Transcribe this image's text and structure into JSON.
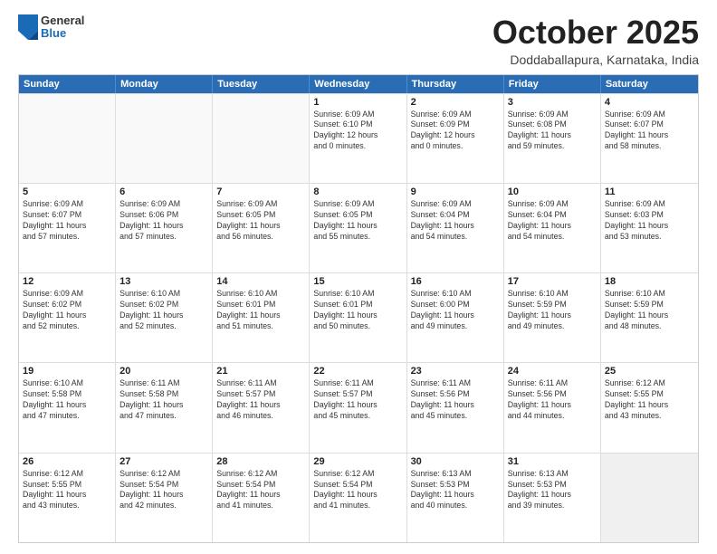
{
  "header": {
    "logo": {
      "general": "General",
      "blue": "Blue"
    },
    "title": "October 2025",
    "location": "Doddaballapura, Karnataka, India"
  },
  "calendar": {
    "weekdays": [
      "Sunday",
      "Monday",
      "Tuesday",
      "Wednesday",
      "Thursday",
      "Friday",
      "Saturday"
    ],
    "weeks": [
      [
        {
          "day": "",
          "lines": [],
          "empty": true
        },
        {
          "day": "",
          "lines": [],
          "empty": true
        },
        {
          "day": "",
          "lines": [],
          "empty": true
        },
        {
          "day": "1",
          "lines": [
            "Sunrise: 6:09 AM",
            "Sunset: 6:10 PM",
            "Daylight: 12 hours",
            "and 0 minutes."
          ]
        },
        {
          "day": "2",
          "lines": [
            "Sunrise: 6:09 AM",
            "Sunset: 6:09 PM",
            "Daylight: 12 hours",
            "and 0 minutes."
          ]
        },
        {
          "day": "3",
          "lines": [
            "Sunrise: 6:09 AM",
            "Sunset: 6:08 PM",
            "Daylight: 11 hours",
            "and 59 minutes."
          ]
        },
        {
          "day": "4",
          "lines": [
            "Sunrise: 6:09 AM",
            "Sunset: 6:07 PM",
            "Daylight: 11 hours",
            "and 58 minutes."
          ]
        }
      ],
      [
        {
          "day": "5",
          "lines": [
            "Sunrise: 6:09 AM",
            "Sunset: 6:07 PM",
            "Daylight: 11 hours",
            "and 57 minutes."
          ]
        },
        {
          "day": "6",
          "lines": [
            "Sunrise: 6:09 AM",
            "Sunset: 6:06 PM",
            "Daylight: 11 hours",
            "and 57 minutes."
          ]
        },
        {
          "day": "7",
          "lines": [
            "Sunrise: 6:09 AM",
            "Sunset: 6:05 PM",
            "Daylight: 11 hours",
            "and 56 minutes."
          ]
        },
        {
          "day": "8",
          "lines": [
            "Sunrise: 6:09 AM",
            "Sunset: 6:05 PM",
            "Daylight: 11 hours",
            "and 55 minutes."
          ]
        },
        {
          "day": "9",
          "lines": [
            "Sunrise: 6:09 AM",
            "Sunset: 6:04 PM",
            "Daylight: 11 hours",
            "and 54 minutes."
          ]
        },
        {
          "day": "10",
          "lines": [
            "Sunrise: 6:09 AM",
            "Sunset: 6:04 PM",
            "Daylight: 11 hours",
            "and 54 minutes."
          ]
        },
        {
          "day": "11",
          "lines": [
            "Sunrise: 6:09 AM",
            "Sunset: 6:03 PM",
            "Daylight: 11 hours",
            "and 53 minutes."
          ]
        }
      ],
      [
        {
          "day": "12",
          "lines": [
            "Sunrise: 6:09 AM",
            "Sunset: 6:02 PM",
            "Daylight: 11 hours",
            "and 52 minutes."
          ]
        },
        {
          "day": "13",
          "lines": [
            "Sunrise: 6:10 AM",
            "Sunset: 6:02 PM",
            "Daylight: 11 hours",
            "and 52 minutes."
          ]
        },
        {
          "day": "14",
          "lines": [
            "Sunrise: 6:10 AM",
            "Sunset: 6:01 PM",
            "Daylight: 11 hours",
            "and 51 minutes."
          ]
        },
        {
          "day": "15",
          "lines": [
            "Sunrise: 6:10 AM",
            "Sunset: 6:01 PM",
            "Daylight: 11 hours",
            "and 50 minutes."
          ]
        },
        {
          "day": "16",
          "lines": [
            "Sunrise: 6:10 AM",
            "Sunset: 6:00 PM",
            "Daylight: 11 hours",
            "and 49 minutes."
          ]
        },
        {
          "day": "17",
          "lines": [
            "Sunrise: 6:10 AM",
            "Sunset: 5:59 PM",
            "Daylight: 11 hours",
            "and 49 minutes."
          ]
        },
        {
          "day": "18",
          "lines": [
            "Sunrise: 6:10 AM",
            "Sunset: 5:59 PM",
            "Daylight: 11 hours",
            "and 48 minutes."
          ]
        }
      ],
      [
        {
          "day": "19",
          "lines": [
            "Sunrise: 6:10 AM",
            "Sunset: 5:58 PM",
            "Daylight: 11 hours",
            "and 47 minutes."
          ]
        },
        {
          "day": "20",
          "lines": [
            "Sunrise: 6:11 AM",
            "Sunset: 5:58 PM",
            "Daylight: 11 hours",
            "and 47 minutes."
          ]
        },
        {
          "day": "21",
          "lines": [
            "Sunrise: 6:11 AM",
            "Sunset: 5:57 PM",
            "Daylight: 11 hours",
            "and 46 minutes."
          ]
        },
        {
          "day": "22",
          "lines": [
            "Sunrise: 6:11 AM",
            "Sunset: 5:57 PM",
            "Daylight: 11 hours",
            "and 45 minutes."
          ]
        },
        {
          "day": "23",
          "lines": [
            "Sunrise: 6:11 AM",
            "Sunset: 5:56 PM",
            "Daylight: 11 hours",
            "and 45 minutes."
          ]
        },
        {
          "day": "24",
          "lines": [
            "Sunrise: 6:11 AM",
            "Sunset: 5:56 PM",
            "Daylight: 11 hours",
            "and 44 minutes."
          ]
        },
        {
          "day": "25",
          "lines": [
            "Sunrise: 6:12 AM",
            "Sunset: 5:55 PM",
            "Daylight: 11 hours",
            "and 43 minutes."
          ]
        }
      ],
      [
        {
          "day": "26",
          "lines": [
            "Sunrise: 6:12 AM",
            "Sunset: 5:55 PM",
            "Daylight: 11 hours",
            "and 43 minutes."
          ]
        },
        {
          "day": "27",
          "lines": [
            "Sunrise: 6:12 AM",
            "Sunset: 5:54 PM",
            "Daylight: 11 hours",
            "and 42 minutes."
          ]
        },
        {
          "day": "28",
          "lines": [
            "Sunrise: 6:12 AM",
            "Sunset: 5:54 PM",
            "Daylight: 11 hours",
            "and 41 minutes."
          ]
        },
        {
          "day": "29",
          "lines": [
            "Sunrise: 6:12 AM",
            "Sunset: 5:54 PM",
            "Daylight: 11 hours",
            "and 41 minutes."
          ]
        },
        {
          "day": "30",
          "lines": [
            "Sunrise: 6:13 AM",
            "Sunset: 5:53 PM",
            "Daylight: 11 hours",
            "and 40 minutes."
          ]
        },
        {
          "day": "31",
          "lines": [
            "Sunrise: 6:13 AM",
            "Sunset: 5:53 PM",
            "Daylight: 11 hours",
            "and 39 minutes."
          ]
        },
        {
          "day": "",
          "lines": [],
          "empty": true,
          "shaded": true
        }
      ]
    ]
  }
}
